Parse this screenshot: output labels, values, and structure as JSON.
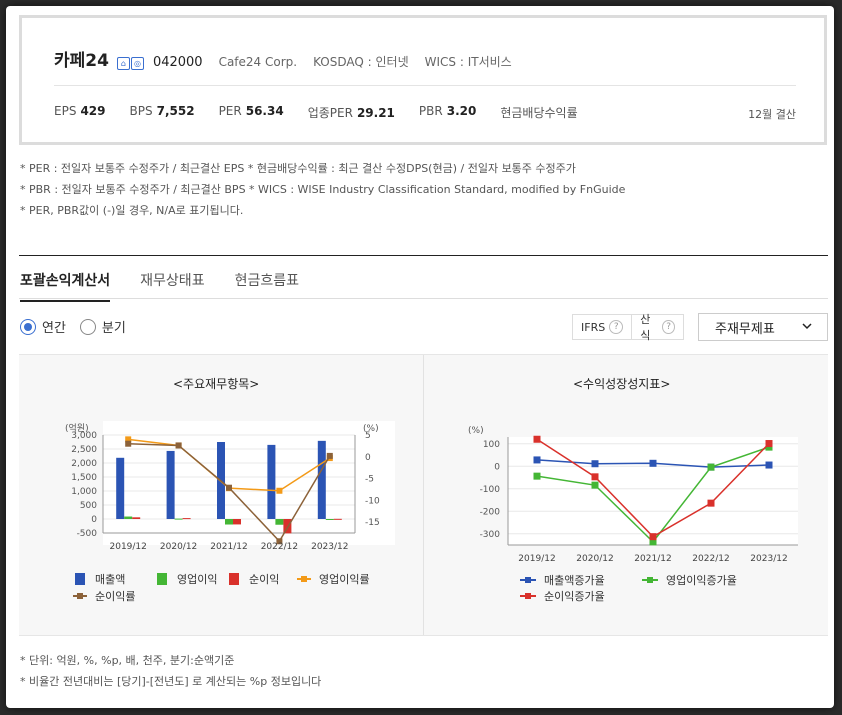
{
  "company": {
    "name": "카페24",
    "code": "042000",
    "english_name": "Cafe24 Corp.",
    "market": "KOSDAQ : 인터넷",
    "wics": "WICS : IT서비스"
  },
  "metrics": [
    {
      "label": "EPS",
      "value": "429"
    },
    {
      "label": "BPS",
      "value": "7,552"
    },
    {
      "label": "PER",
      "value": "56.34"
    },
    {
      "label": "업종PER",
      "value": "29.21"
    },
    {
      "label": "PBR",
      "value": "3.20"
    },
    {
      "label": "현금배당수익률",
      "value": ""
    }
  ],
  "settlement": "12월 결산",
  "notes": [
    "* PER : 전일자 보통주 수정주가 / 최근결산 EPS * 현금배당수익률 : 최근 결산 수정DPS(현금) / 전일자 보통주 수정주가",
    "* PBR : 전일자 보통주 수정주가 / 최근결산 BPS * WICS : WISE Industry Classification Standard, modified by FnGuide",
    "* PER, PBR값이 (-)일 경우, N/A로 표기됩니다."
  ],
  "tabs": [
    "포괄손익계산서",
    "재무상태표",
    "현금흐름표"
  ],
  "period_options": [
    "연간",
    "분기"
  ],
  "option_labels": {
    "ifrs": "IFRS",
    "calc": "산식",
    "help": "?"
  },
  "select_value": "주재무제표",
  "chart_titles": [
    "<주요재무항목>",
    "<수익성장성지표>"
  ],
  "bottom_notes": [
    "* 단위: 억원, %, %p, 배, 천주, 분기:순액기준",
    "* 비율간 전년대비는 [당기]-[전년도] 로 계산되는 %p 정보입니다"
  ],
  "chart_data": [
    {
      "type": "bar",
      "categories": [
        "2019/12",
        "2020/12",
        "2021/12",
        "2022/12",
        "2023/12"
      ],
      "left_unit": "(억원)",
      "right_unit": "(%)",
      "left_ylim": [
        -500,
        3000
      ],
      "left_ticks": [
        "3,000",
        "2,500",
        "2,000",
        "1,500",
        "1,000",
        "500",
        "0",
        "-500"
      ],
      "right_ylim": [
        -17.5,
        5
      ],
      "right_ticks": [
        "5",
        "0",
        "-5",
        "-10",
        "-15"
      ],
      "bar_series": [
        {
          "name": "매출액",
          "color": "#2b54b4",
          "values": [
            2186,
            2431,
            2750,
            2647,
            2791
          ]
        },
        {
          "name": "영업이익",
          "color": "#44b635",
          "values": [
            88,
            14,
            -197,
            -205,
            -7
          ]
        },
        {
          "name": "순이익",
          "color": "#d9312b",
          "values": [
            60,
            32,
            -194,
            -513,
            6
          ]
        }
      ],
      "line_series": [
        {
          "name": "영업이익률",
          "color": "#f39a18",
          "values": [
            4.0,
            2.6,
            -7.2,
            -7.8,
            -0.3
          ]
        },
        {
          "name": "순이익률",
          "color": "#8c6239",
          "values": [
            3.0,
            2.6,
            -7.1,
            -19.4,
            0.2
          ]
        }
      ]
    },
    {
      "type": "line",
      "categories": [
        "2019/12",
        "2020/12",
        "2021/12",
        "2022/12",
        "2023/12"
      ],
      "unit": "(%)",
      "ylim": [
        -350,
        130
      ],
      "ticks": [
        "100",
        "0",
        "-100",
        "-200",
        "-300"
      ],
      "series": [
        {
          "name": "매출액증가율",
          "color": "#2b54b4",
          "values": [
            28.1,
            11.2,
            13.1,
            -3.7,
            5.4
          ]
        },
        {
          "name": "영업이익증가율",
          "color": "#44b635",
          "values": [
            -44,
            -84,
            -336,
            -4,
            85
          ]
        },
        {
          "name": "순이익증가율",
          "color": "#d9312b",
          "values": [
            120,
            -47,
            -313,
            -164,
            101
          ]
        }
      ]
    }
  ]
}
